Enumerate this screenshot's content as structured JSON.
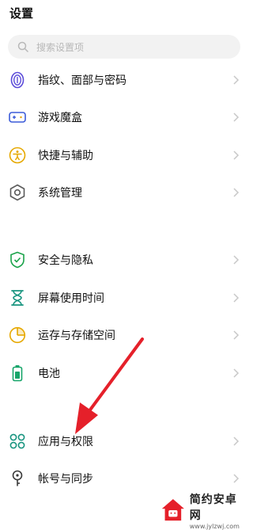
{
  "header": {
    "title": "设置"
  },
  "search": {
    "placeholder": "搜索设置项"
  },
  "groups": [
    {
      "items": [
        {
          "label": "指纹、面部与密码",
          "icon": "fingerprint-icon",
          "color": "#5b4bd9"
        },
        {
          "label": "游戏魔盒",
          "icon": "game-icon",
          "color": "#3b5bd9"
        },
        {
          "label": "快捷与辅助",
          "icon": "accessibility-icon",
          "color": "#e6a800"
        },
        {
          "label": "系统管理",
          "icon": "system-gear-icon",
          "color": "#5a5a5a"
        }
      ]
    },
    {
      "items": [
        {
          "label": "安全与隐私",
          "icon": "shield-icon",
          "color": "#1aa34a"
        },
        {
          "label": "屏幕使用时间",
          "icon": "hourglass-icon",
          "color": "#17947f"
        },
        {
          "label": "运存与存储空间",
          "icon": "storage-icon",
          "color": "#e6a800"
        },
        {
          "label": "电池",
          "icon": "battery-icon",
          "color": "#17a56a"
        }
      ]
    },
    {
      "items": [
        {
          "label": "应用与权限",
          "icon": "apps-icon",
          "color": "#17947f"
        },
        {
          "label": "帐号与同步",
          "icon": "account-key-icon",
          "color": "#3a3a3a"
        }
      ]
    }
  ],
  "watermark": {
    "title": "简约安卓网",
    "url": "www.jylzwj.com"
  },
  "colors": {
    "arrow": "#e5202a",
    "chevron": "#c8c8c8"
  }
}
